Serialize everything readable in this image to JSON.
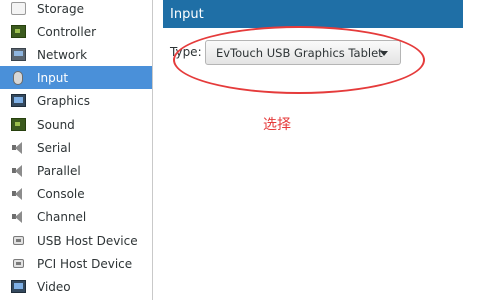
{
  "sidebar": {
    "items": [
      {
        "label": "Storage",
        "icon": "storage-icon"
      },
      {
        "label": "Controller",
        "icon": "controller-icon"
      },
      {
        "label": "Network",
        "icon": "network-icon"
      },
      {
        "label": "Input",
        "icon": "mouse-icon",
        "selected": true
      },
      {
        "label": "Graphics",
        "icon": "monitor-icon"
      },
      {
        "label": "Sound",
        "icon": "sound-card-icon"
      },
      {
        "label": "Serial",
        "icon": "speaker-icon"
      },
      {
        "label": "Parallel",
        "icon": "speaker-icon"
      },
      {
        "label": "Console",
        "icon": "speaker-icon"
      },
      {
        "label": "Channel",
        "icon": "speaker-icon"
      },
      {
        "label": "USB Host Device",
        "icon": "usb-icon"
      },
      {
        "label": "PCI Host Device",
        "icon": "usb-icon"
      },
      {
        "label": "Video",
        "icon": "monitor-icon"
      }
    ]
  },
  "main": {
    "header_title": "Input",
    "type_label": "Type:",
    "type_value": "EvTouch USB Graphics Tablet"
  },
  "annotation": {
    "text": "选择",
    "color": "#e53b3b"
  },
  "colors": {
    "header_bg": "#1f6fa6",
    "selected_bg": "#4a90d9"
  }
}
